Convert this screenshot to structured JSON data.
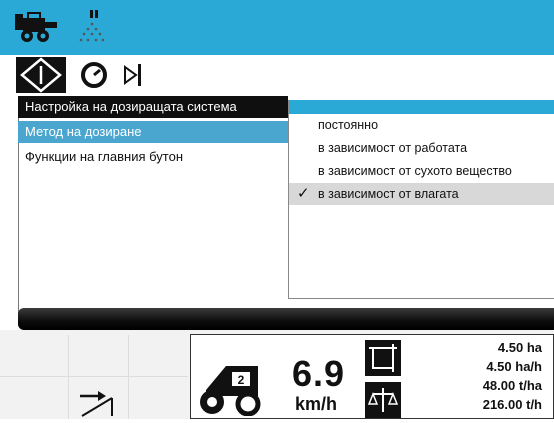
{
  "header": {
    "icons": [
      "harvester-icon",
      "sprayer-icon"
    ],
    "color": "#2aa8d6"
  },
  "toolbar": {
    "icons": [
      "navigation-diamond-icon",
      "gauge-icon",
      "arrow-to-bar-icon"
    ]
  },
  "menu": {
    "title": "Настройка на дозиращата система",
    "items": [
      {
        "label": "Метод на дозиране",
        "selected": true
      },
      {
        "label": "Функции на главния бутон",
        "selected": false
      }
    ]
  },
  "dosing_method_popup": {
    "options": [
      {
        "label": "постоянно",
        "checked": false
      },
      {
        "label": "в зависимост от работата",
        "checked": false
      },
      {
        "label": "в зависимост от сухото вещество",
        "checked": false
      },
      {
        "label": "в зависимост от влагата",
        "checked": true
      }
    ]
  },
  "dashboard": {
    "speed": {
      "value": "6.9",
      "unit": "km/h"
    },
    "stats": [
      {
        "value": "4.50",
        "unit": "ha"
      },
      {
        "value": "4.50",
        "unit": "ha/h"
      },
      {
        "value": "48.00",
        "unit": "t/ha"
      },
      {
        "value": "216.00",
        "unit": "t/h"
      }
    ]
  }
}
